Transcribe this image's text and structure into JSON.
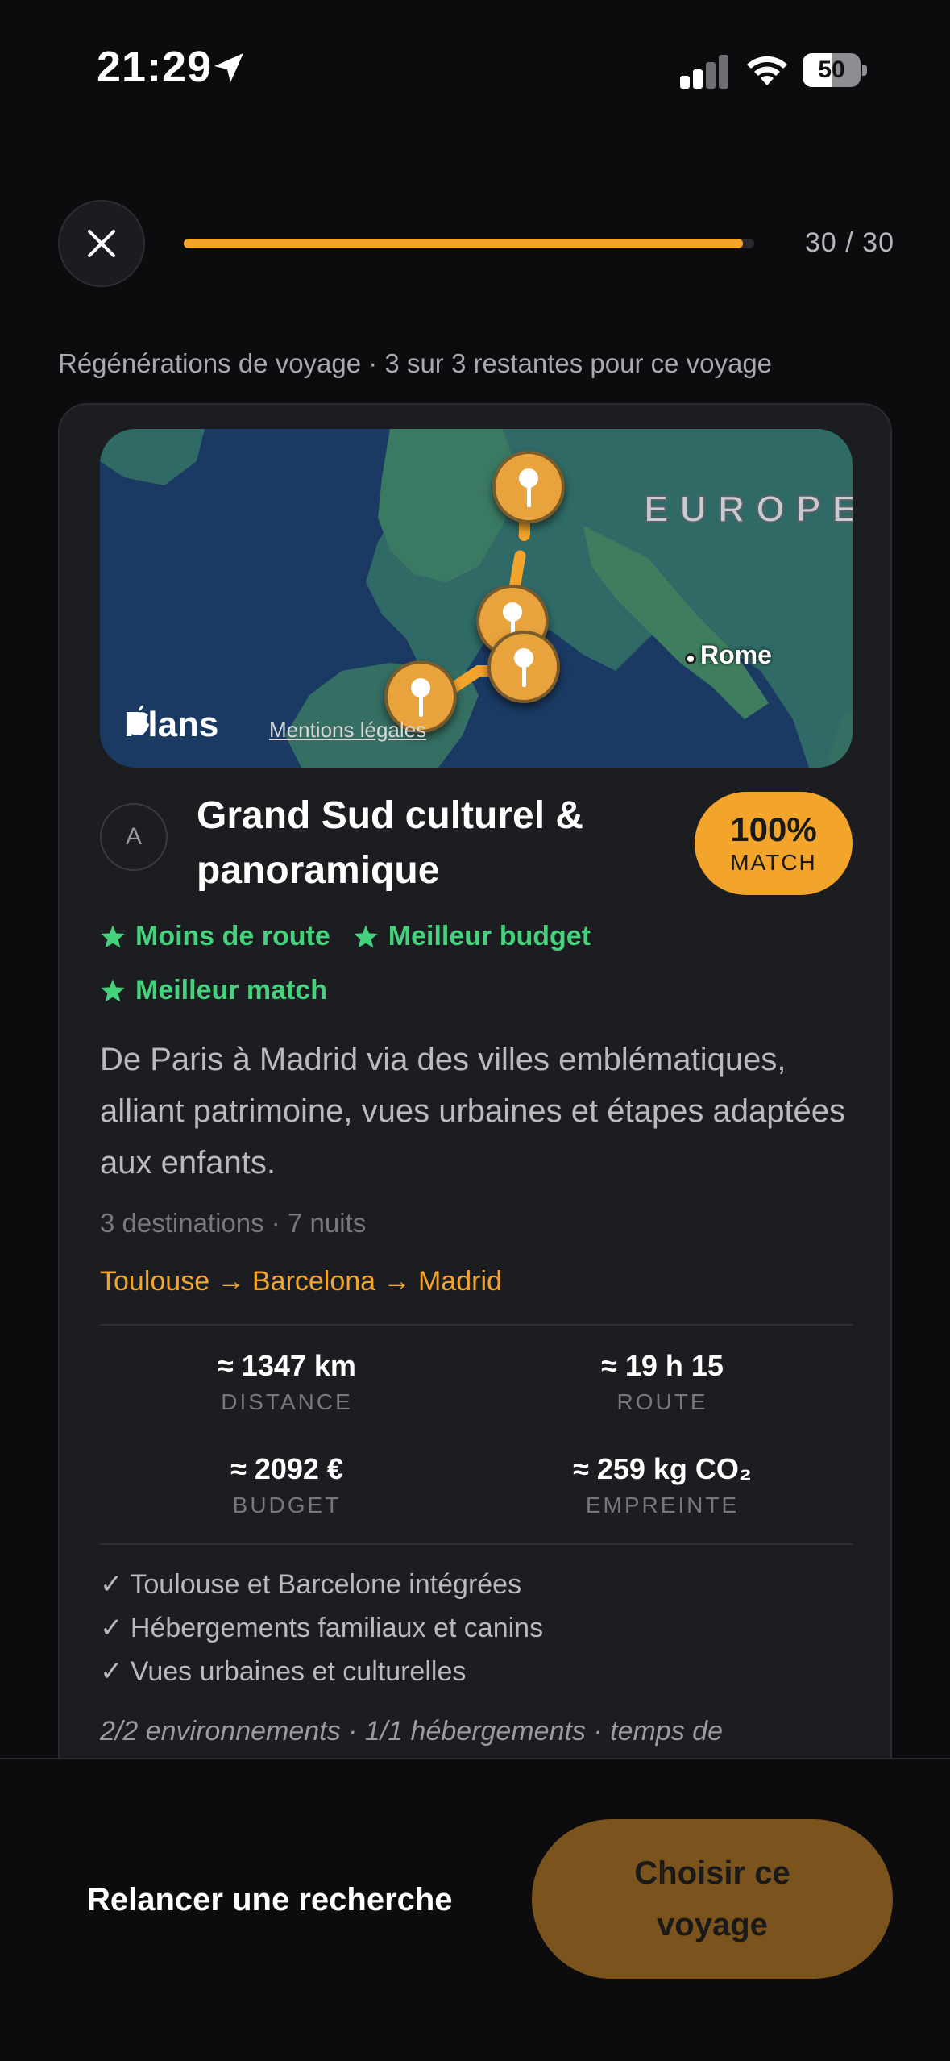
{
  "status_bar": {
    "time": "21:29",
    "battery_level": "50",
    "battery_fraction": 0.5
  },
  "header": {
    "progress_text": "30 / 30",
    "progress_fraction": 0.98
  },
  "regen_note": "Régénérations de voyage · 3 sur 3 restantes pour ce voyage",
  "map": {
    "region_label": "EUROPE",
    "city_label": "Rome",
    "brand": "Plans",
    "legal_link": "Mentions légales"
  },
  "trip": {
    "avatar_letter": "A",
    "title": "Grand Sud culturel & panoramique",
    "match_percent": "100%",
    "match_label": "MATCH",
    "tags": [
      "Moins de route",
      "Meilleur budget",
      "Meilleur match"
    ],
    "description": "De Paris à Madrid via des villes emblématiques, alliant patrimoine, vues urbaines et étapes adaptées aux enfants.",
    "meta": "3 destinations · 7 nuits",
    "route": "Toulouse → Barcelona → Madrid",
    "stats": {
      "distance_value": "≈ 1347 km",
      "distance_label": "DISTANCE",
      "route_value": "≈ 19 h 15",
      "route_label": "ROUTE",
      "budget_value": "≈ 2092 €",
      "budget_label": "BUDGET",
      "footprint_value": "≈ 259 kg CO₂",
      "footprint_label": "EMPREINTE"
    },
    "checks": [
      "✓ Toulouse et Barcelone intégrées",
      "✓ Hébergements familiaux et canins",
      "✓ Vues urbaines et culturelles"
    ],
    "footnote": "2/2 environnements · 1/1 hébergements · temps de"
  },
  "bottom_bar": {
    "relaunch_label": "Relancer une recherche",
    "choose_label": "Choisir ce voyage"
  },
  "colors": {
    "accent": "#f3a42b",
    "tag_green": "#46d17c",
    "choose_button_bg": "#7a541c",
    "card_bg": "#1c1d21"
  }
}
